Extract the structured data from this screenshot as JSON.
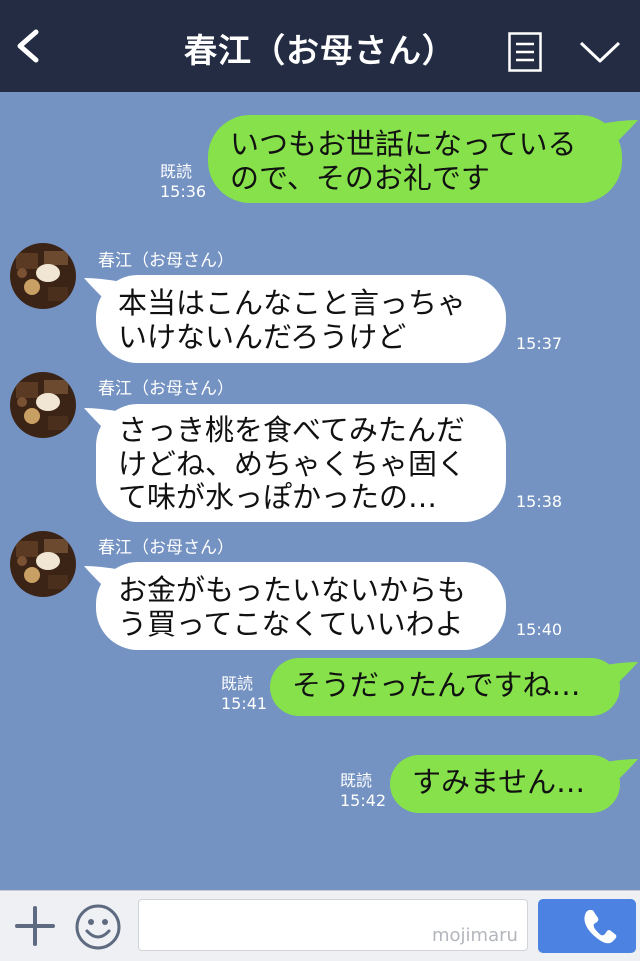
{
  "header": {
    "title": "春江（お母さん）"
  },
  "messages": [
    {
      "side": "me",
      "text": "いつもお世話になっている\nので、そのお礼です",
      "read": "既読",
      "time": "15:36"
    },
    {
      "side": "them",
      "sender": "春江（お母さん）",
      "text": "本当はこんなこと言っちゃ\nいけないんだろうけど",
      "time": "15:37"
    },
    {
      "side": "them",
      "sender": "春江（お母さん）",
      "text": "さっき桃を食べてみたんだ\nけどね、めちゃくちゃ固く\nて味が水っぽかったの…",
      "time": "15:38"
    },
    {
      "side": "them",
      "sender": "春江（お母さん）",
      "text": "お金がもったいないからも\nう買ってこなくていいわよ",
      "time": "15:40"
    },
    {
      "side": "me",
      "text": "そうだったんですね…",
      "read": "既読",
      "time": "15:41"
    },
    {
      "side": "me",
      "text": "すみません…",
      "read": "既読",
      "time": "15:42"
    }
  ],
  "input": {
    "placeholder": "",
    "watermark": "mojimaru"
  },
  "colors": {
    "header": "#232c43",
    "background": "#7493c3",
    "my_bubble": "#86e14b",
    "their_bubble": "#ffffff",
    "send": "#4c83e3"
  },
  "icons": [
    "back-arrow-icon",
    "menu-icon",
    "chevron-down-icon",
    "plus-icon",
    "emoji-icon",
    "phone-icon"
  ]
}
